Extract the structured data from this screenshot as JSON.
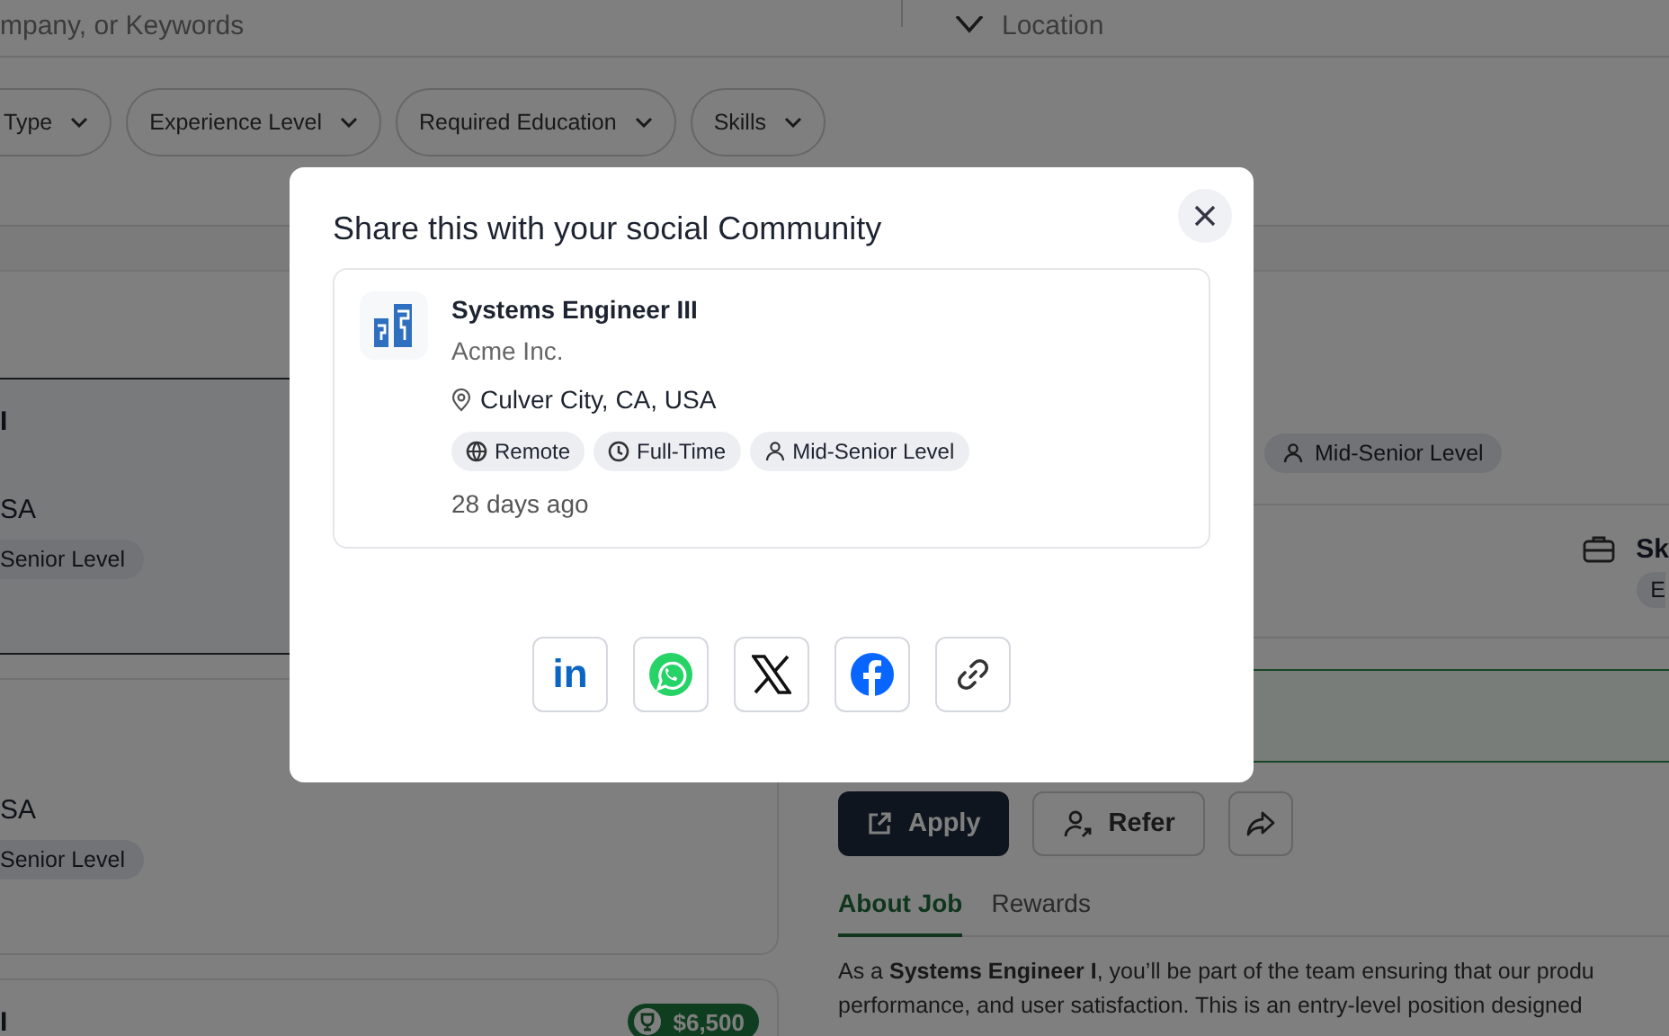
{
  "search": {
    "keyword_placeholder": "mpany, or Keywords",
    "location_placeholder": "Location"
  },
  "filters": [
    "Type",
    "Experience Level",
    "Required Education",
    "Skills"
  ],
  "job_list": [
    {
      "title": "I",
      "location": "SA",
      "level": "Senior Level",
      "selected": true
    },
    {
      "location": "SA",
      "level": "Senior Level",
      "selected": false
    },
    {
      "title": "I",
      "reward": "$6,500",
      "selected": false
    }
  ],
  "job_detail": {
    "level_chip": "Mid-Senior Level",
    "skills_label": "Sk",
    "skills_chip": "E",
    "apply": "Apply",
    "refer": "Refer",
    "tabs": [
      {
        "label": "About Job",
        "selected": true
      },
      {
        "label": "Rewards",
        "selected": false
      }
    ],
    "description_lines": [
      "As a **Systems Engineer I**, you’ll be part of the team ensuring that our produ",
      "performance, and user satisfaction. This is an entry-level position designed"
    ]
  },
  "share_dialog": {
    "title": "Share this with your social Community",
    "job": {
      "title": "Systems Engineer III",
      "company": "Acme Inc.",
      "location": "Culver City, CA, USA",
      "tags": [
        {
          "kind": "remote",
          "label": "Remote"
        },
        {
          "kind": "schedule",
          "label": "Full-Time"
        },
        {
          "kind": "level",
          "label": "Mid-Senior Level"
        }
      ],
      "posted": "28 days ago"
    },
    "share_targets": [
      {
        "kind": "linkedin",
        "glyph": "in"
      },
      {
        "kind": "whatsapp"
      },
      {
        "kind": "x"
      },
      {
        "kind": "facebook"
      },
      {
        "kind": "link"
      }
    ]
  }
}
